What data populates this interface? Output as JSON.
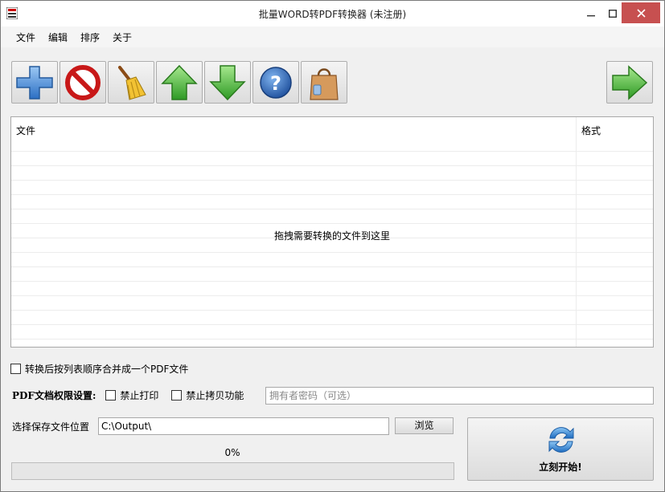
{
  "window": {
    "title": "批量WORD转PDF转换器 (未注册)"
  },
  "menu": [
    "文件",
    "编辑",
    "排序",
    "关于"
  ],
  "toolbar": {
    "buttons": [
      "add",
      "remove",
      "clear",
      "move-up",
      "move-down",
      "help",
      "buy"
    ],
    "next": "next"
  },
  "file_list": {
    "columns": [
      "文件",
      "格式"
    ],
    "rows": [],
    "drop_hint": "拖拽需要转换的文件到这里"
  },
  "options": {
    "merge_label": "转换后按列表顺序合并成一个PDF文件",
    "merge_checked": false,
    "permission_label": "PDF文档权限设置:",
    "no_print_label": "禁止打印",
    "no_print_checked": false,
    "no_copy_label": "禁止拷贝功能",
    "no_copy_checked": false,
    "owner_password_placeholder": "拥有者密码（可选）",
    "owner_password_value": ""
  },
  "output": {
    "label": "选择保存文件位置",
    "path": "C:\\Output\\",
    "browse_label": "浏览"
  },
  "progress": {
    "text": "0%",
    "value": 0
  },
  "start": {
    "label": "立刻开始!"
  },
  "colors": {
    "close_button": "#c75050",
    "accent_blue": "#2f7fd8",
    "accent_green": "#3aa832"
  }
}
